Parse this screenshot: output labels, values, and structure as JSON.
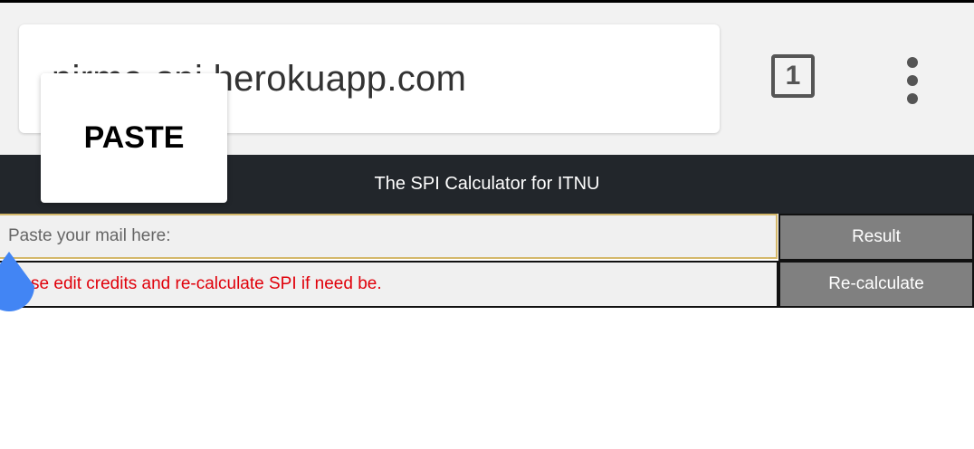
{
  "browser": {
    "url": "nirma-spi.herokuapp.com",
    "tab_count": "1",
    "menu_icon": "overflow-menu-icon"
  },
  "context_menu": {
    "paste_label": "PASTE"
  },
  "app": {
    "title": "The SPI Calculator for ITNU",
    "mail_input": {
      "placeholder": "Paste your mail here:",
      "value": ""
    },
    "result_button": "Result",
    "notice": "Please edit credits and re-calculate SPI if need be.",
    "recalculate_button": "Re-calculate"
  },
  "colors": {
    "header_bg": "#22262b",
    "button_bg": "#808080",
    "notice_text": "#e0000a",
    "cursor_handle": "#4285f4"
  }
}
